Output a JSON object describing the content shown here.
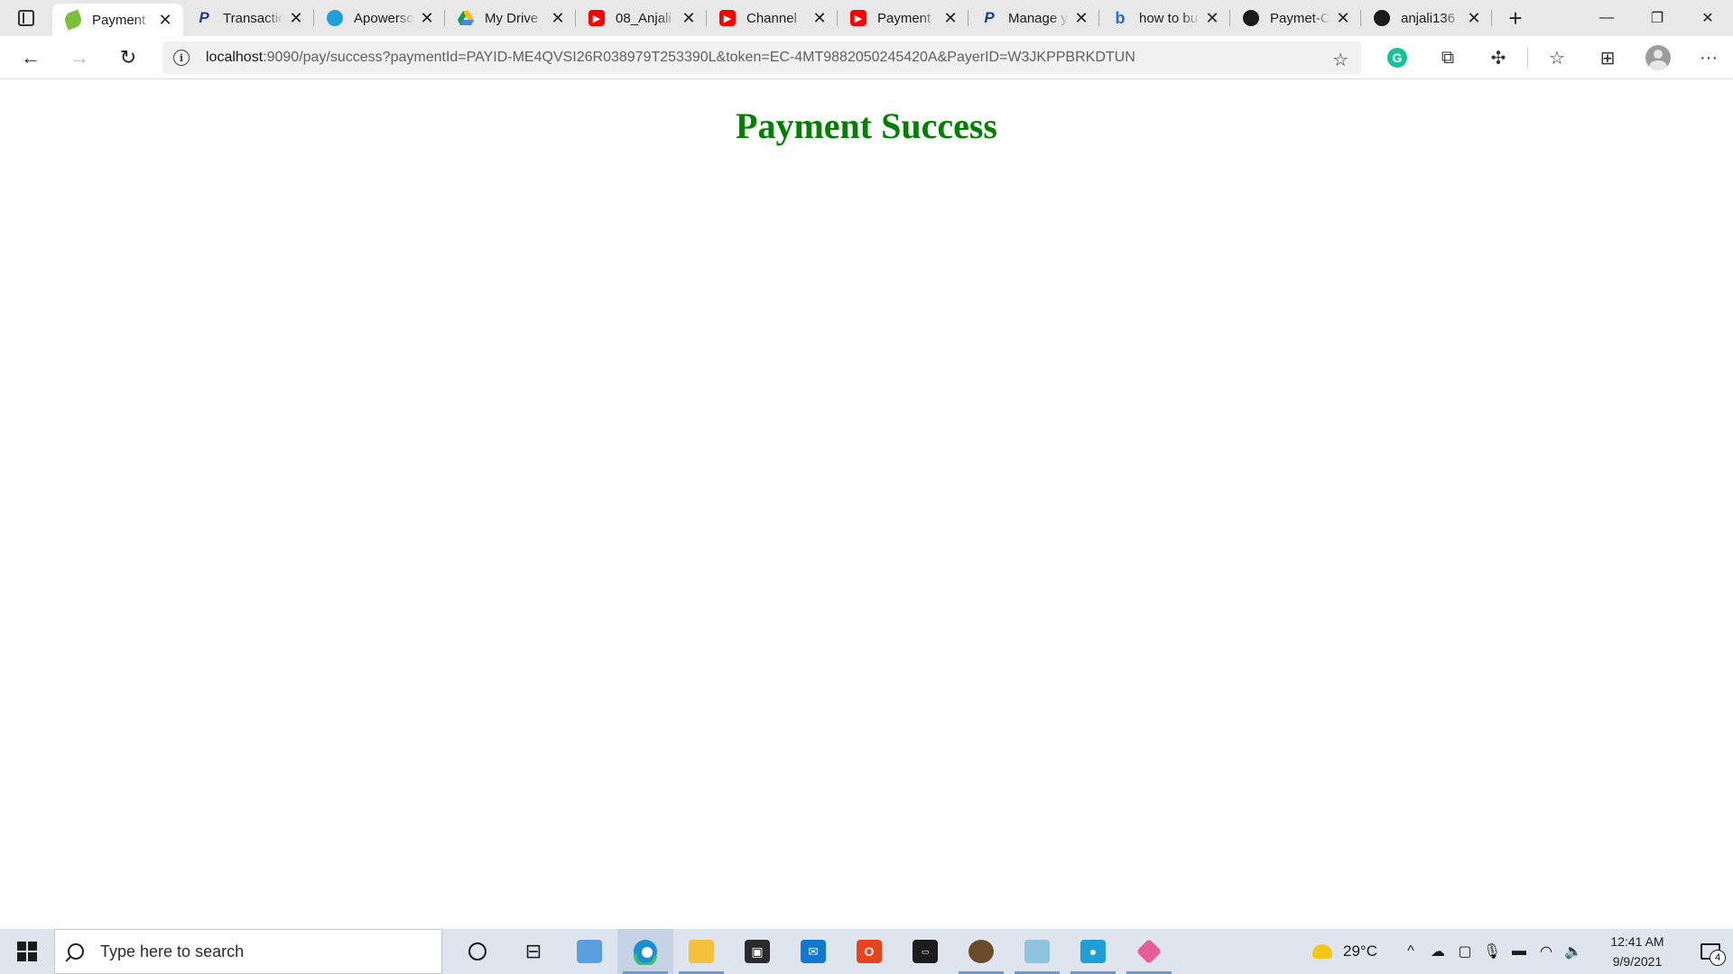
{
  "browser": {
    "tabs": [
      {
        "title": "Payment",
        "favicon": "spring-leaf-icon",
        "active": true
      },
      {
        "title": "Transaction",
        "favicon": "paypal-icon",
        "active": false
      },
      {
        "title": "Apowersoft",
        "favicon": "apowersoft-icon",
        "active": false
      },
      {
        "title": "My Drive",
        "favicon": "google-drive-icon",
        "active": false
      },
      {
        "title": "08_Anjali",
        "favicon": "youtube-icon",
        "active": false
      },
      {
        "title": "Channel",
        "favicon": "youtube-icon",
        "active": false
      },
      {
        "title": "Payment",
        "favicon": "youtube-icon",
        "active": false
      },
      {
        "title": "Manage y",
        "favicon": "paypal-icon",
        "active": false
      },
      {
        "title": "how to bu",
        "favicon": "bing-icon",
        "active": false
      },
      {
        "title": "Paymet-C",
        "favicon": "github-icon",
        "active": false
      },
      {
        "title": "anjali136",
        "favicon": "github-icon",
        "active": false
      }
    ],
    "address": {
      "host": "localhost",
      "rest": ":9090/pay/success?paymentId=PAYID-ME4QVSI26R038979T253390L&token=EC-4MT9882050245420A&PayerID=W3JKPPBRKDTUN"
    }
  },
  "page": {
    "heading": "Payment Success",
    "heading_color": "#008000"
  },
  "taskbar": {
    "search_placeholder": "Type here to search",
    "weather": "29°C",
    "time": "12:41 AM",
    "date": "9/9/2021",
    "notification_count": "4"
  }
}
